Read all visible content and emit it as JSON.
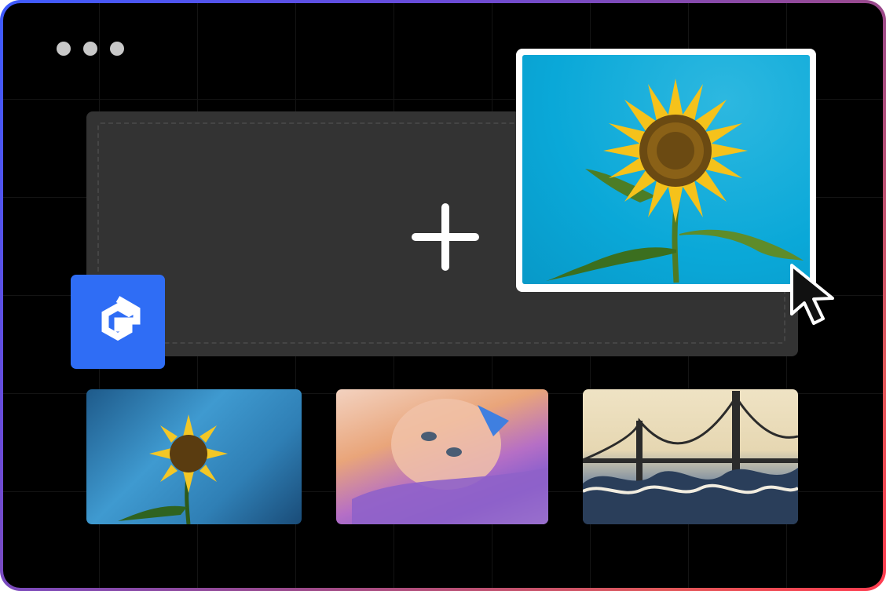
{
  "window": {
    "dots": [
      "close",
      "minimize",
      "maximize"
    ]
  },
  "upload": {
    "icon": "plus-icon",
    "preview_image": "sunflower-photo",
    "cursor_icon": "arrow-cursor-icon"
  },
  "brand": {
    "logo_icon": "g-hexagon-logo-icon",
    "color": "#2f6df5"
  },
  "gallery": {
    "items": [
      {
        "name": "sunflower-van-gogh-style"
      },
      {
        "name": "portrait-watercolor-style"
      },
      {
        "name": "golden-gate-bridge-wave-style"
      }
    ]
  },
  "colors": {
    "background": "#000000",
    "dropzone": "#333333",
    "frame_gradient_start": "#3d5bff",
    "frame_gradient_end": "#ff3b4f"
  }
}
